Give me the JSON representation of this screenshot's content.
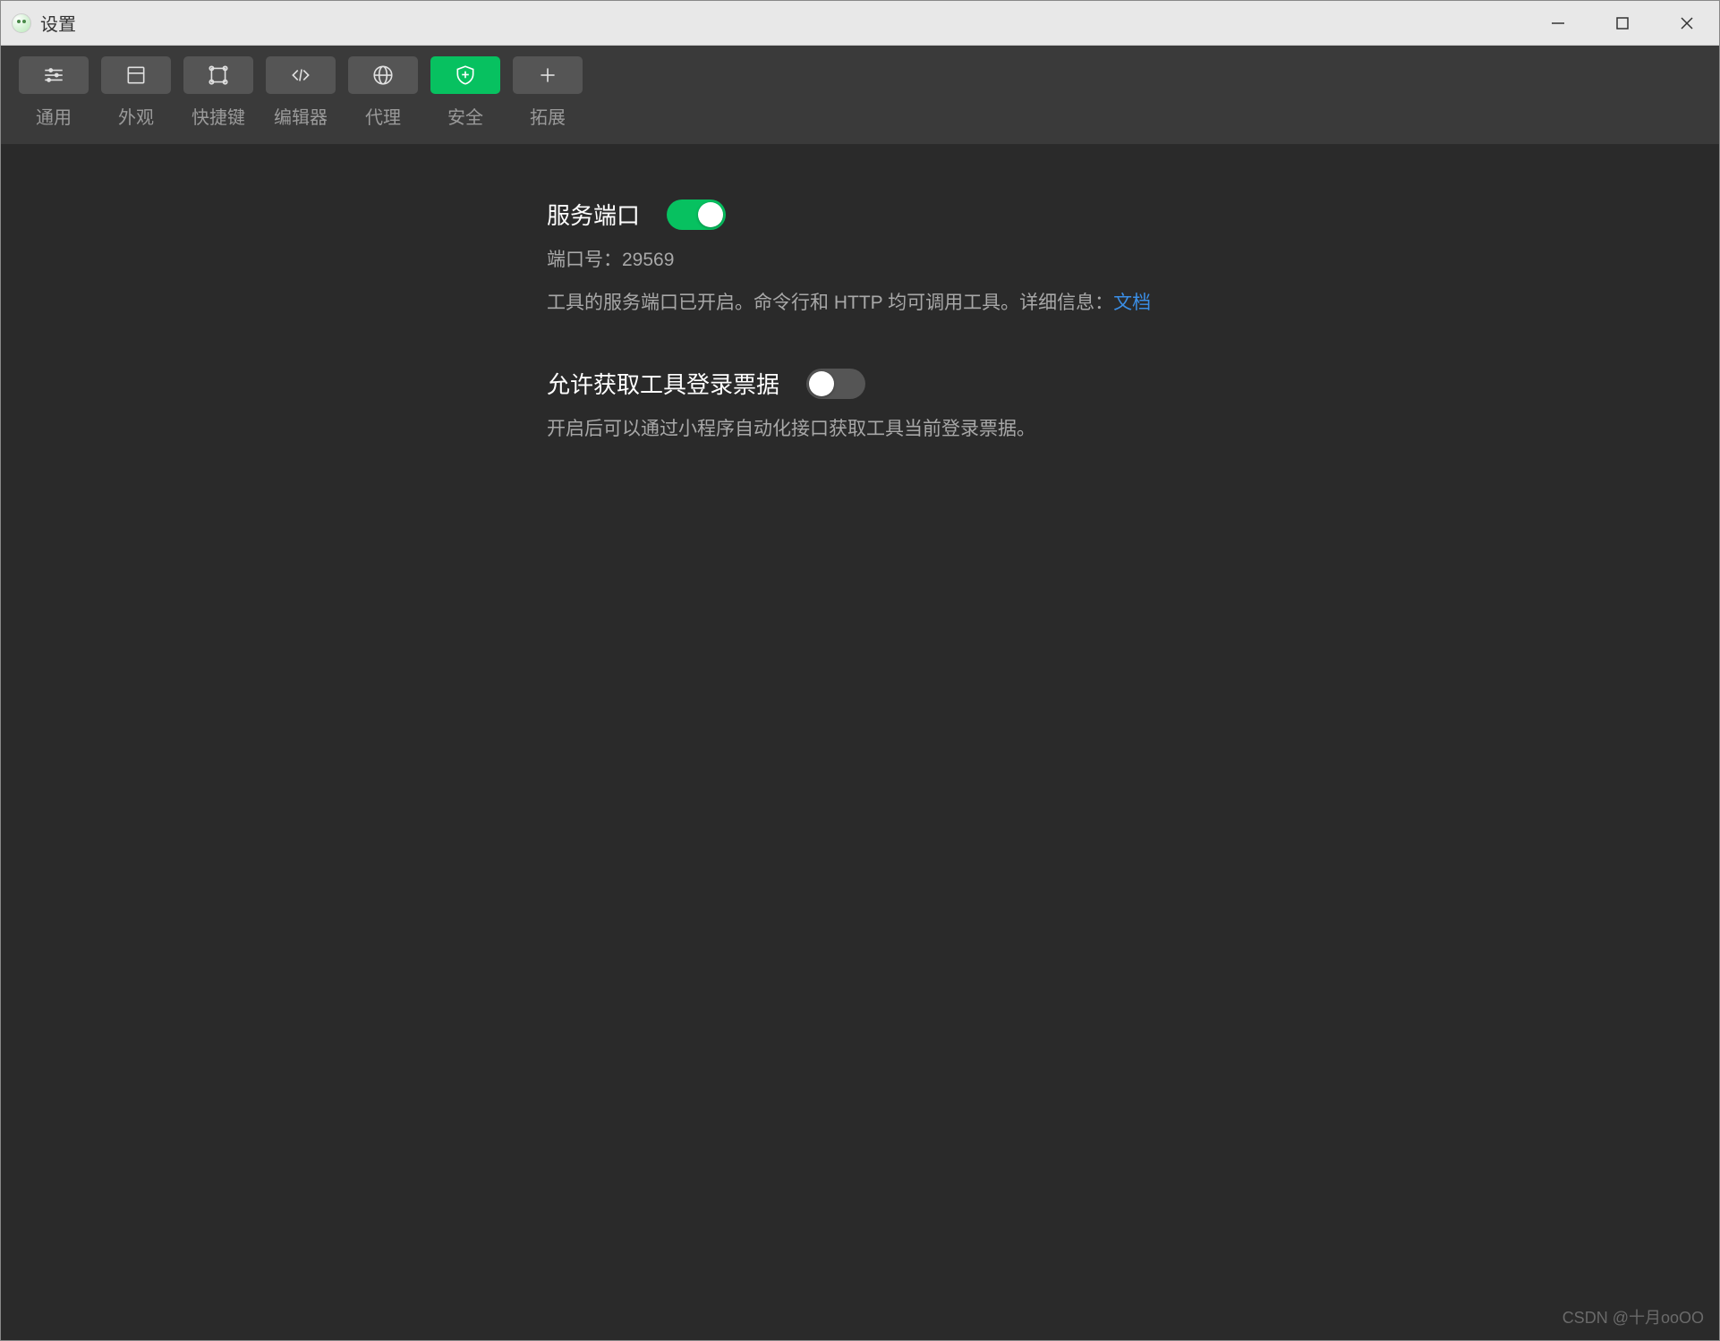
{
  "window": {
    "title": "设置"
  },
  "tabs": [
    {
      "label": "通用",
      "icon": "sliders"
    },
    {
      "label": "外观",
      "icon": "layout"
    },
    {
      "label": "快捷键",
      "icon": "keyboard"
    },
    {
      "label": "编辑器",
      "icon": "code"
    },
    {
      "label": "代理",
      "icon": "globe"
    },
    {
      "label": "安全",
      "icon": "shield",
      "active": true
    },
    {
      "label": "拓展",
      "icon": "plus"
    }
  ],
  "settings": {
    "service_port": {
      "title": "服务端口",
      "enabled": true,
      "port_label": "端口号：",
      "port_value": "29569",
      "description": "工具的服务端口已开启。命令行和 HTTP 均可调用工具。详细信息：",
      "link_text": "文档"
    },
    "login_ticket": {
      "title": "允许获取工具登录票据",
      "enabled": false,
      "description": "开启后可以通过小程序自动化接口获取工具当前登录票据。"
    }
  },
  "watermark": "CSDN @十月ooOO"
}
